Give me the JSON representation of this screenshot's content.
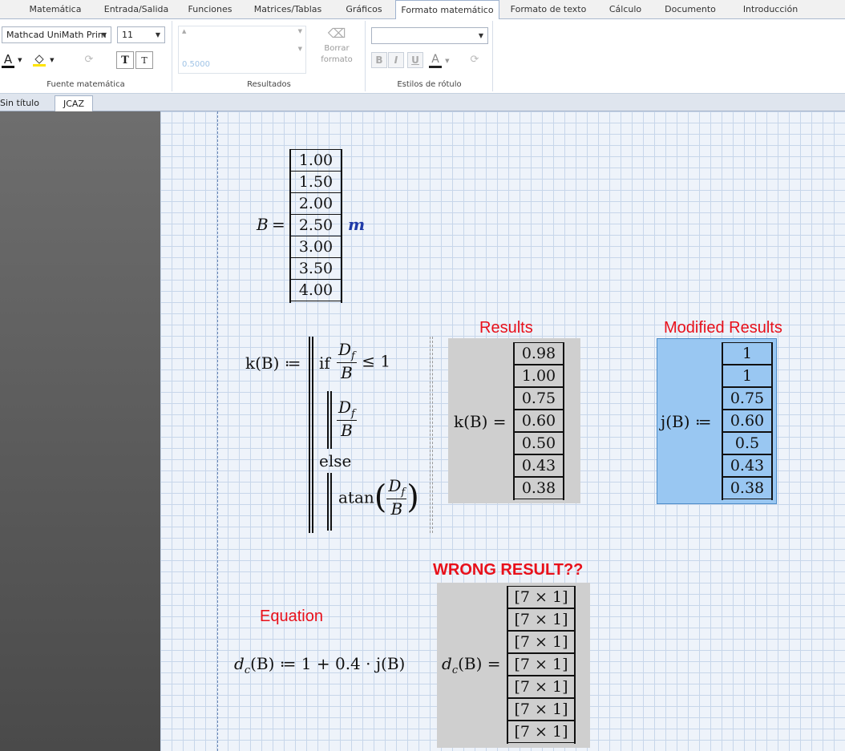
{
  "ribbon_tabs": [
    "Matemática",
    "Entrada/Salida",
    "Funciones",
    "Matrices/Tablas",
    "Gráficos",
    "Formato matemático",
    "Formato de texto",
    "Cálculo",
    "Documento",
    "Introducción"
  ],
  "active_tab": "Formato matemático",
  "font_group": {
    "font_name": "Mathcad UniMath Prim",
    "font_size": "11",
    "label": "Fuente matemática",
    "font_color_glyph": "A",
    "text_btn_1": "T",
    "text_btn_2": "T"
  },
  "results_group": {
    "value": "0.5000",
    "clear_label_1": "Borrar",
    "clear_label_2": "formato",
    "label": "Resultados"
  },
  "label_styles_group": {
    "style_value": "",
    "bold": "B",
    "italic": "I",
    "underline": "U",
    "color_glyph": "A",
    "label": "Estilos de rótulo"
  },
  "doc_tabs": [
    "Sin título",
    "JCAZ"
  ],
  "worksheet": {
    "b_def": {
      "lhs": "B",
      "op": "=",
      "values": [
        "1.00",
        "1.50",
        "2.00",
        "2.50",
        "3.00",
        "3.50",
        "4.00"
      ],
      "unit": "m"
    },
    "k_def": {
      "head": "k(B) ≔",
      "if_kw": "if",
      "cond_num": "D",
      "cond_sub": "f",
      "cond_den": "B",
      "cond_rhs": "≤ 1",
      "then_num": "D",
      "then_sub": "f",
      "then_den": "B",
      "else_kw": "else",
      "atan": "atan",
      "atan_num": "D",
      "atan_sub": "f",
      "atan_den": "B"
    },
    "results_label": "Results",
    "k_result": {
      "lhs": "k(B) =",
      "values": [
        "0.98",
        "1.00",
        "0.75",
        "0.60",
        "0.50",
        "0.43",
        "0.38"
      ]
    },
    "modified_label": "Modified Results",
    "j_def": {
      "lhs": "j(B) ≔",
      "values": [
        "1",
        "1",
        "0.75",
        "0.60",
        "0.5",
        "0.43",
        "0.38"
      ]
    },
    "wrong_label": "WRONG RESULT??",
    "equation_label": "Equation",
    "dc_def": {
      "d": "d",
      "sub": "c",
      "rest": "(B) ≔ 1 + 0.4 · j(B)"
    },
    "dc_result": {
      "d": "d",
      "sub": "c",
      "rest": "(B) =",
      "values": [
        "[7 × 1]",
        "[7 × 1]",
        "[7 × 1]",
        "[7 × 1]",
        "[7 × 1]",
        "[7 × 1]",
        "[7 × 1]"
      ]
    }
  },
  "colors": {
    "label_red": "#e8101a",
    "result_gray": "#cfcfcf",
    "modified_blue": "#99c7f2",
    "unit_blue": "#1f3aa8"
  }
}
